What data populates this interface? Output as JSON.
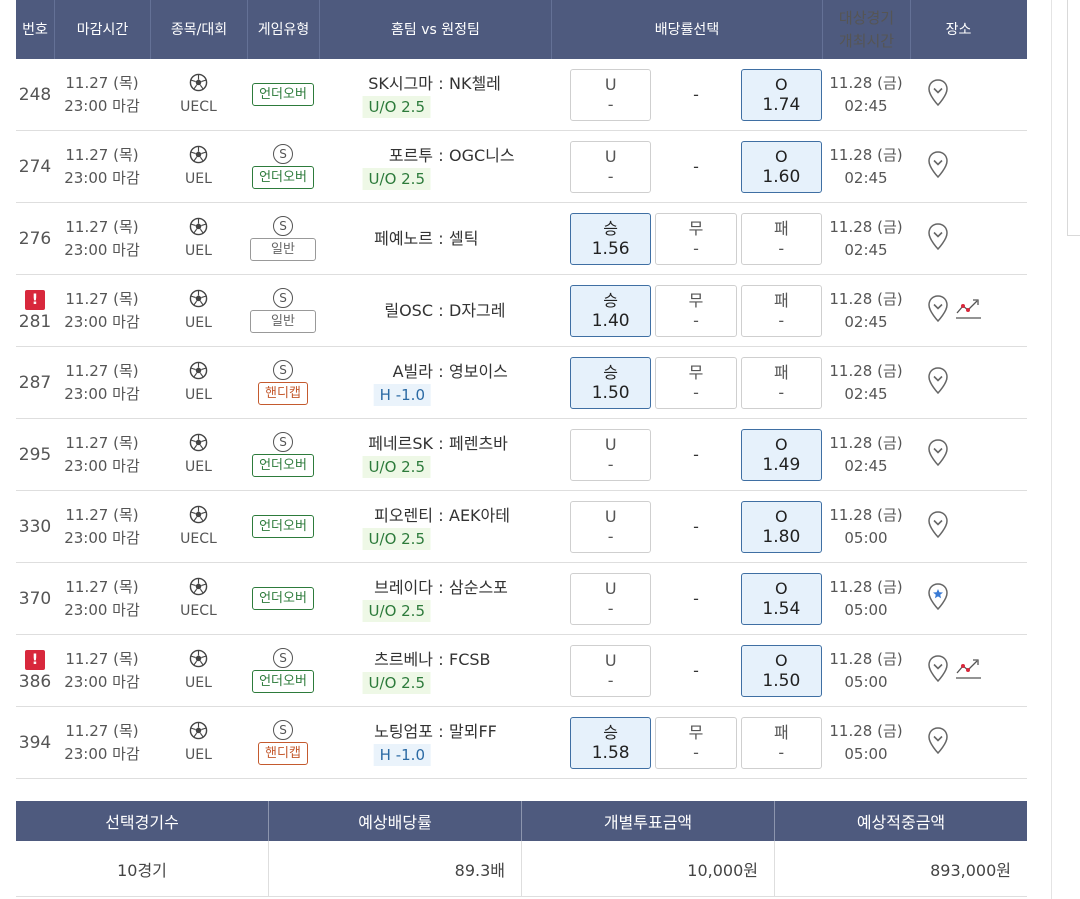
{
  "header": {
    "num": "번호",
    "deadline": "마감시간",
    "sport": "종목/대회",
    "game_type": "게임유형",
    "match": "홈팀 vs 원정팀",
    "odds": "배당률선택",
    "start_line1": "대상경기",
    "start_line2": "개최시간",
    "place": "장소"
  },
  "rows": [
    {
      "num": "248",
      "alert": "",
      "date": "11.27 (목)",
      "deadline": "23:00 마감",
      "league": "UECL",
      "s": "",
      "type": "언더오버",
      "home": "SK시그마",
      "sep": ":",
      "away": "NK첼레",
      "tag": "U/O 2.5",
      "o1": "U",
      "o1v": "-",
      "mid": "-",
      "o2": "",
      "o2v": "",
      "o3": "O",
      "o3v": "1.74",
      "sdate": "11.28 (금)",
      "stime": "02:45"
    },
    {
      "num": "274",
      "alert": "",
      "date": "11.27 (목)",
      "deadline": "23:00 마감",
      "league": "UEL",
      "s": "S",
      "type": "언더오버",
      "home": "포르투",
      "sep": ":",
      "away": "OGC니스",
      "tag": "U/O 2.5",
      "o1": "U",
      "o1v": "-",
      "mid": "-",
      "o2": "",
      "o2v": "",
      "o3": "O",
      "o3v": "1.60",
      "sdate": "11.28 (금)",
      "stime": "02:45"
    },
    {
      "num": "276",
      "alert": "",
      "date": "11.27 (목)",
      "deadline": "23:00 마감",
      "league": "UEL",
      "s": "S",
      "type": "일반",
      "home": "페예노르",
      "sep": ":",
      "away": "셀틱",
      "tag": "",
      "o1": "승",
      "o1v": "1.56",
      "mid": "",
      "o2": "무",
      "o2v": "-",
      "o3": "패",
      "o3v": "-",
      "sdate": "11.28 (금)",
      "stime": "02:45"
    },
    {
      "num": "281",
      "alert": "!",
      "date": "11.27 (목)",
      "deadline": "23:00 마감",
      "league": "UEL",
      "s": "S",
      "type": "일반",
      "home": "릴OSC",
      "sep": ":",
      "away": "D자그레",
      "tag": "",
      "o1": "승",
      "o1v": "1.40",
      "mid": "",
      "o2": "무",
      "o2v": "-",
      "o3": "패",
      "o3v": "-",
      "sdate": "11.28 (금)",
      "stime": "02:45"
    },
    {
      "num": "287",
      "alert": "",
      "date": "11.27 (목)",
      "deadline": "23:00 마감",
      "league": "UEL",
      "s": "S",
      "type": "핸디캡",
      "home": "A빌라",
      "sep": ":",
      "away": "영보이스",
      "tag": "H -1.0",
      "o1": "승",
      "o1v": "1.50",
      "mid": "",
      "o2": "무",
      "o2v": "-",
      "o3": "패",
      "o3v": "-",
      "sdate": "11.28 (금)",
      "stime": "02:45"
    },
    {
      "num": "295",
      "alert": "",
      "date": "11.27 (목)",
      "deadline": "23:00 마감",
      "league": "UEL",
      "s": "S",
      "type": "언더오버",
      "home": "페네르SK",
      "sep": ":",
      "away": "페렌츠바",
      "tag": "U/O 2.5",
      "o1": "U",
      "o1v": "-",
      "mid": "-",
      "o2": "",
      "o2v": "",
      "o3": "O",
      "o3v": "1.49",
      "sdate": "11.28 (금)",
      "stime": "02:45"
    },
    {
      "num": "330",
      "alert": "",
      "date": "11.27 (목)",
      "deadline": "23:00 마감",
      "league": "UECL",
      "s": "",
      "type": "언더오버",
      "home": "피오렌티",
      "sep": ":",
      "away": "AEK아테",
      "tag": "U/O 2.5",
      "o1": "U",
      "o1v": "-",
      "mid": "-",
      "o2": "",
      "o2v": "",
      "o3": "O",
      "o3v": "1.80",
      "sdate": "11.28 (금)",
      "stime": "05:00"
    },
    {
      "num": "370",
      "alert": "",
      "date": "11.27 (목)",
      "deadline": "23:00 마감",
      "league": "UECL",
      "s": "",
      "type": "언더오버",
      "home": "브레이다",
      "sep": ":",
      "away": "삼순스포",
      "tag": "U/O 2.5",
      "o1": "U",
      "o1v": "-",
      "mid": "-",
      "o2": "",
      "o2v": "",
      "o3": "O",
      "o3v": "1.54",
      "sdate": "11.28 (금)",
      "stime": "05:00"
    },
    {
      "num": "386",
      "alert": "!",
      "date": "11.27 (목)",
      "deadline": "23:00 마감",
      "league": "UEL",
      "s": "S",
      "type": "언더오버",
      "home": "츠르베나",
      "sep": ":",
      "away": "FCSB",
      "tag": "U/O 2.5",
      "o1": "U",
      "o1v": "-",
      "mid": "-",
      "o2": "",
      "o2v": "",
      "o3": "O",
      "o3v": "1.50",
      "sdate": "11.28 (금)",
      "stime": "05:00"
    },
    {
      "num": "394",
      "alert": "",
      "date": "11.27 (목)",
      "deadline": "23:00 마감",
      "league": "UEL",
      "s": "S",
      "type": "핸디캡",
      "home": "노팅엄포",
      "sep": ":",
      "away": "말뫼FF",
      "tag": "H -1.0",
      "o1": "승",
      "o1v": "1.58",
      "mid": "",
      "o2": "무",
      "o2v": "-",
      "o3": "패",
      "o3v": "-",
      "sdate": "11.28 (금)",
      "stime": "05:00"
    }
  ],
  "place_icons": [
    "pin-icon",
    "pin-icon",
    "pin-icon",
    "pin-icon+trend-icon",
    "pin-icon",
    "pin-icon",
    "pin-icon",
    "star-pin-icon",
    "pin-icon+trend-icon",
    "pin-icon"
  ],
  "summary": {
    "headers": [
      "선택경기수",
      "예상배당률",
      "개별투표금액",
      "예상적중금액"
    ],
    "values": [
      "10경기",
      "89.3배",
      "10,000원",
      "893,000원"
    ]
  },
  "colors": {
    "header_bg": "#4e5a7e",
    "selected_bg": "#e6f1fb",
    "selected_border": "#3f6fa3",
    "alert": "#d8283c",
    "uo_green": "#2d7b3b",
    "handicap_orange": "#c45a2e",
    "star_pin": "#3a7bd5"
  }
}
